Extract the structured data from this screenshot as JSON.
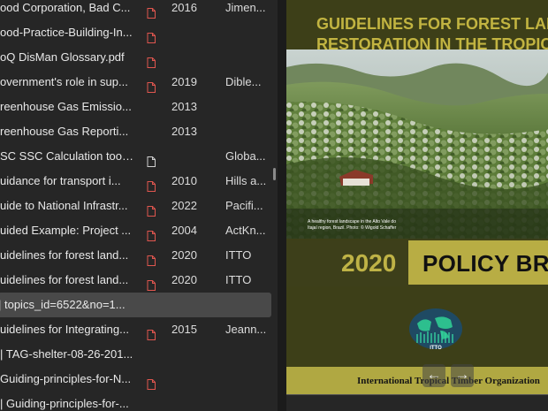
{
  "items": [
    {
      "title": "ood Corporation, Bad C...",
      "icon": "pdf-icon",
      "year": "2016",
      "author": "Jimen..."
    },
    {
      "title": "ood-Practice-Building-In...",
      "icon": "pdf-icon",
      "year": "",
      "author": ""
    },
    {
      "title": "oQ DisMan Glossary.pdf",
      "icon": "pdf-icon",
      "year": "",
      "author": ""
    },
    {
      "title": "overnment's role in sup...",
      "icon": "pdf-icon",
      "year": "2019",
      "author": "Dible..."
    },
    {
      "title": "reenhouse Gas Emissio...",
      "icon": "",
      "year": "2013",
      "author": ""
    },
    {
      "title": "reenhouse Gas Reporti...",
      "icon": "",
      "year": "2013",
      "author": ""
    },
    {
      "title": "SC SSC Calculation tool_...",
      "icon": "document-icon",
      "year": "",
      "author": "Globa..."
    },
    {
      "title": "uidance for transport i...",
      "icon": "pdf-icon",
      "year": "2010",
      "author": "Hills a..."
    },
    {
      "title": "uide to National Infrastr...",
      "icon": "pdf-icon",
      "year": "2022",
      "author": "Pacifi..."
    },
    {
      "title": "uided Example: Project ...",
      "icon": "pdf-icon",
      "year": "2004",
      "author": "ActKn..."
    },
    {
      "title": "uidelines for forest land...",
      "icon": "pdf-icon",
      "year": "2020",
      "author": "ITTO"
    },
    {
      "title": "uidelines for forest land...",
      "icon": "pdf-icon",
      "year": "2020",
      "author": "ITTO"
    },
    {
      "title": "| topics_id=6522&no=1...",
      "icon": "",
      "year": "",
      "author": "",
      "selected": true
    },
    {
      "title": "uidelines for Integrating...",
      "icon": "pdf-icon",
      "year": "2015",
      "author": "Jeann..."
    },
    {
      "title": "| TAG-shelter-08-26-201...",
      "icon": "",
      "year": "",
      "author": ""
    },
    {
      "title": "Guiding-principles-for-N...",
      "icon": "pdf-icon",
      "year": "",
      "author": ""
    },
    {
      "title": "| Guiding-principles-for-...",
      "icon": "",
      "year": "",
      "author": ""
    }
  ],
  "preview": {
    "title_line1": "GUIDELINES FOR FOREST LANDSCAPE",
    "title_line2": "RESTORATION IN THE TROPICS",
    "caption": "A healthy forest landscape in the Alto Vale do Itajaí region, Brazil. Photo: © Wigold Schaffer",
    "year": "2020",
    "policy_label": "POLICY BRIEF",
    "logo_text": "ITTO",
    "organization": "International Tropical Timber Organization",
    "nav_prev": "←",
    "nav_next": "→"
  },
  "colors": {
    "cover_olive": "#3d3f18",
    "cover_gold": "#b8ad44",
    "selected_row": "#494949"
  }
}
